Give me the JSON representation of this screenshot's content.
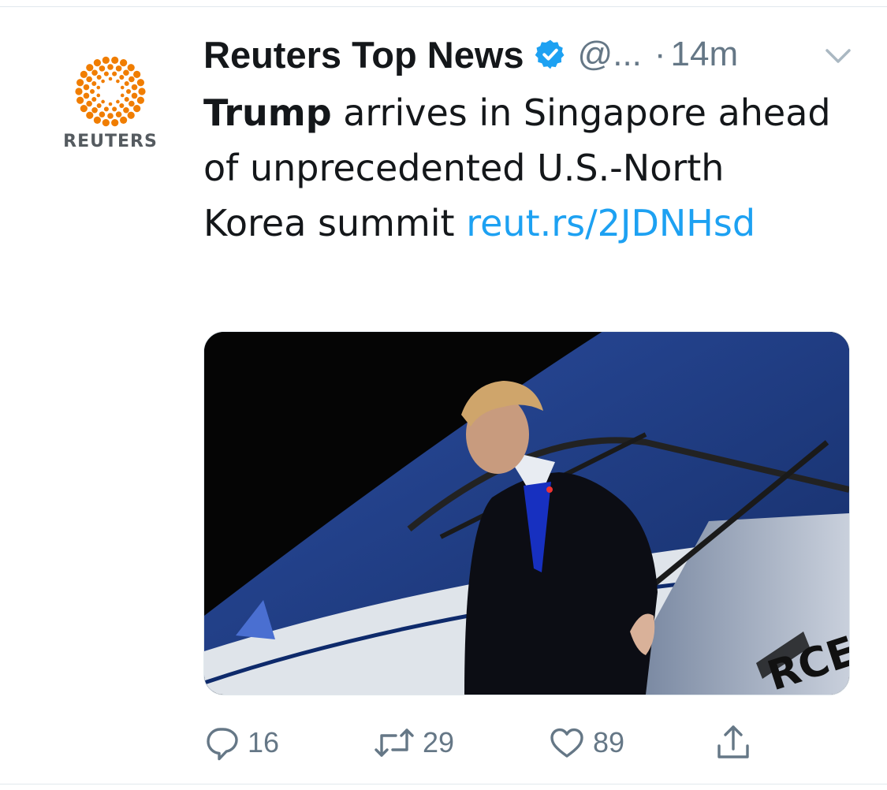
{
  "account": {
    "avatar_name": "REUTERS",
    "display_name": "Reuters Top News",
    "handle": "@...",
    "separator": "·",
    "time": "14m",
    "verified": true
  },
  "tweet": {
    "bold_word": "Trump",
    "text": " arrives in Singapore ahead of unprecedented U.S.-North Korea summit ",
    "link": "reut.rs/2JDNHsd"
  },
  "actions": {
    "reply_count": "16",
    "retweet_count": "29",
    "like_count": "89"
  },
  "colors": {
    "link": "#1da1f2",
    "verified": "#1da1f2",
    "meta_gray": "#657786",
    "reuters_orange": "#f07d00"
  },
  "icons": [
    "reuters-logo-icon",
    "verified-badge-icon",
    "chevron-down-icon",
    "reply-icon",
    "retweet-icon",
    "like-icon",
    "share-icon"
  ]
}
